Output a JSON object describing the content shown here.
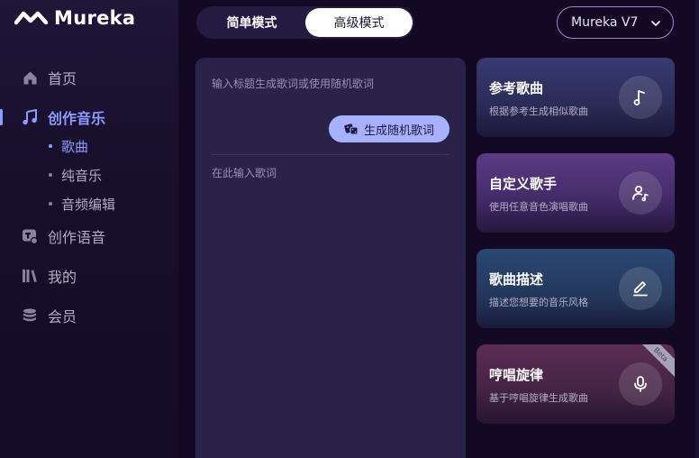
{
  "brand": {
    "name": "Mureka"
  },
  "sidebar": {
    "items": [
      {
        "label": "首页",
        "icon": "home-icon"
      },
      {
        "label": "创作音乐",
        "icon": "music-note-icon",
        "active": true,
        "children": [
          {
            "label": "歌曲",
            "active": true
          },
          {
            "label": "纯音乐"
          },
          {
            "label": "音频编辑"
          }
        ]
      },
      {
        "label": "创作语音",
        "icon": "voice-icon"
      },
      {
        "label": "我的",
        "icon": "library-icon"
      },
      {
        "label": "会员",
        "icon": "membership-icon"
      }
    ]
  },
  "header": {
    "mode_simple": "简单模式",
    "mode_advanced": "高级模式",
    "selected_mode": "高级模式",
    "model": "Mureka V7"
  },
  "lyrics": {
    "title_placeholder": "输入标题生成歌词或使用随机歌词",
    "random_button": "生成随机歌词",
    "lyrics_placeholder": "在此输入歌词"
  },
  "cards": [
    {
      "title": "参考歌曲",
      "desc": "根据参考生成相似歌曲",
      "icon": "music-note-icon"
    },
    {
      "title": "自定义歌手",
      "desc": "使用任意音色演唱歌曲",
      "icon": "singer-icon"
    },
    {
      "title": "歌曲描述",
      "desc": "描述您想要的音乐风格",
      "icon": "edit-icon"
    },
    {
      "title": "哼唱旋律",
      "desc": "基于哼唱旋律生成歌曲",
      "icon": "microphone-icon",
      "badge": "Beta"
    }
  ],
  "colors": {
    "accent": "#8f9cff",
    "random_button_bg": "#a6b2ff",
    "panel_bg": "#2a2248",
    "page_bg": "#130925"
  }
}
